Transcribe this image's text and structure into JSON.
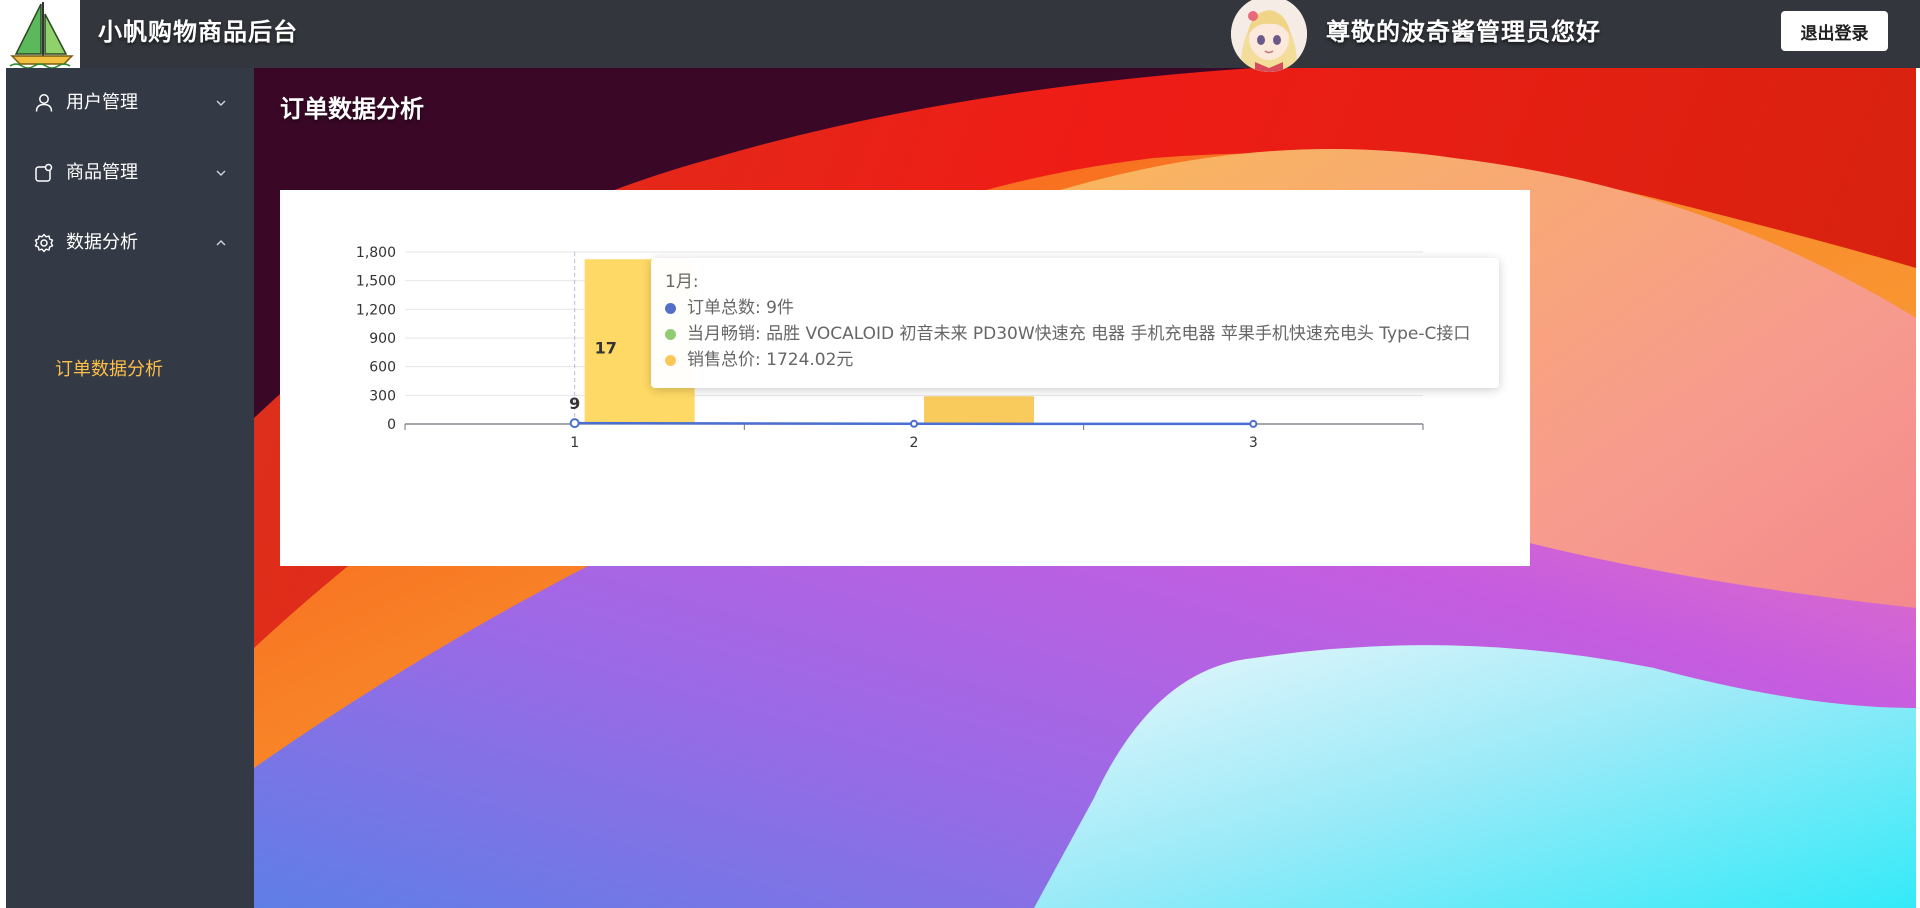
{
  "header": {
    "app_title": "小帆购物商品后台",
    "greeting": "尊敬的波奇酱管理员您好",
    "logout_label": "退出登录"
  },
  "sidebar": {
    "items": [
      {
        "label": "用户管理",
        "icon": "user-icon",
        "expanded": false
      },
      {
        "label": "商品管理",
        "icon": "product-icon",
        "expanded": false
      },
      {
        "label": "数据分析",
        "icon": "gear-icon",
        "expanded": true
      }
    ],
    "subitems": [
      {
        "label": "订单数据分析",
        "active": true
      }
    ]
  },
  "main": {
    "page_title": "订单数据分析"
  },
  "colors": {
    "header_bg": "#33373d",
    "sidebar_bg": "#343a45",
    "submenu_active": "#fdbf49",
    "bar_color": "#fdd35a",
    "line_color": "#4a6fd0",
    "legend_line": "#5470c6",
    "legend_top": "#91cc75",
    "legend_sales": "#fac858"
  },
  "chart_data": {
    "type": "bar",
    "categories": [
      "1",
      "2",
      "3"
    ],
    "y_ticks": [
      "1,800",
      "1,500",
      "1,200",
      "900",
      "600",
      "300",
      "0"
    ],
    "ylim": [
      0,
      1800
    ],
    "grid": true,
    "series": [
      {
        "name": "订单总数",
        "type": "line",
        "values": [
          9,
          2,
          1
        ]
      },
      {
        "name": "销售总价",
        "type": "bar",
        "values": [
          1724.02,
          290,
          0
        ]
      }
    ],
    "data_labels": {
      "line_first": "9",
      "bar_first_partial": "17"
    },
    "tooltip": {
      "title": "1月:",
      "rows": [
        "订单总数: 9件",
        "当月畅销: 品胜 VOCALOID 初音未来 PD30W快速充 电器 手机充电器 苹果手机快速充电头 Type-C接口",
        "销售总价: 1724.02元"
      ]
    }
  }
}
